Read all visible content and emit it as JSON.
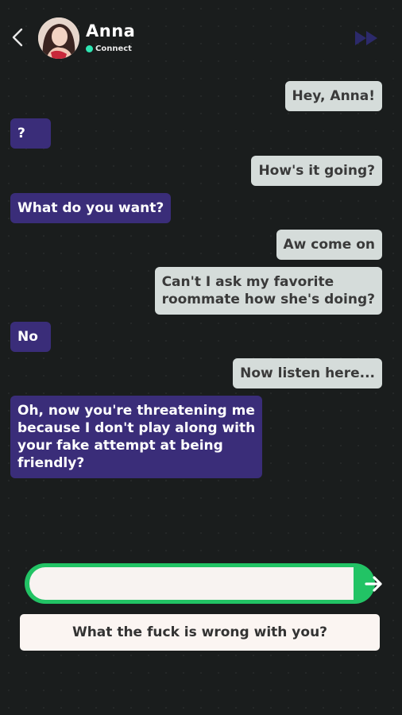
{
  "header": {
    "name": "Anna",
    "status_text": "Connect",
    "status_color": "#2ee6b3",
    "back_icon": "chevron-left-icon",
    "skip_icon": "fast-forward-icon"
  },
  "messages": [
    {
      "from": "user",
      "text": "Hey, Anna!"
    },
    {
      "from": "anna",
      "text": "?"
    },
    {
      "from": "user",
      "text": "How's it going?"
    },
    {
      "from": "anna",
      "text": "What do you want?"
    },
    {
      "from": "user",
      "text": "Aw come on"
    },
    {
      "from": "user",
      "lines": [
        "Can't I ask my favorite",
        "roommate how she's doing?"
      ]
    },
    {
      "from": "anna",
      "text": "No"
    },
    {
      "from": "user",
      "text": "Now listen here..."
    },
    {
      "from": "anna",
      "lines": [
        "Oh, now you're threatening me",
        "because I don't play along with",
        "your fake attempt at being",
        "friendly?"
      ]
    }
  ],
  "composer": {
    "value": "",
    "send_icon": "send-icon"
  },
  "suggestion": {
    "text": "What the fuck is wrong with you?"
  },
  "colors": {
    "background": "#1a1d1d",
    "sent_bubble": "#d5dcda",
    "received_bubble": "#3a2d79",
    "accent_green": "#22c365"
  }
}
